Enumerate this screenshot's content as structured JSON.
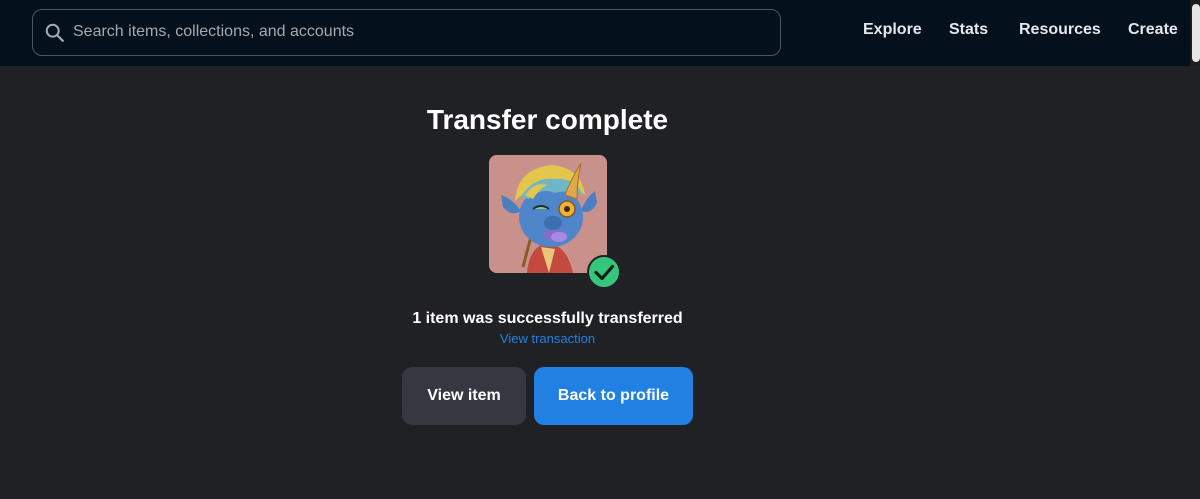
{
  "search": {
    "placeholder": "Search items, collections, and accounts",
    "value": ""
  },
  "nav": {
    "items": [
      {
        "label": "Explore"
      },
      {
        "label": "Stats"
      },
      {
        "label": "Resources"
      },
      {
        "label": "Create"
      }
    ]
  },
  "main": {
    "title": "Transfer complete",
    "message": "1 item was successfully transferred",
    "transaction_link": "View transaction",
    "buttons": {
      "view_item": "View item",
      "back_to_profile": "Back to profile"
    }
  },
  "icons": {
    "search": "search-icon",
    "success": "check-circle-icon"
  },
  "colors": {
    "background": "#202124",
    "topbar": "#04111d",
    "primary": "#2081e2",
    "secondary_button": "#353840",
    "success": "#34c77b"
  }
}
